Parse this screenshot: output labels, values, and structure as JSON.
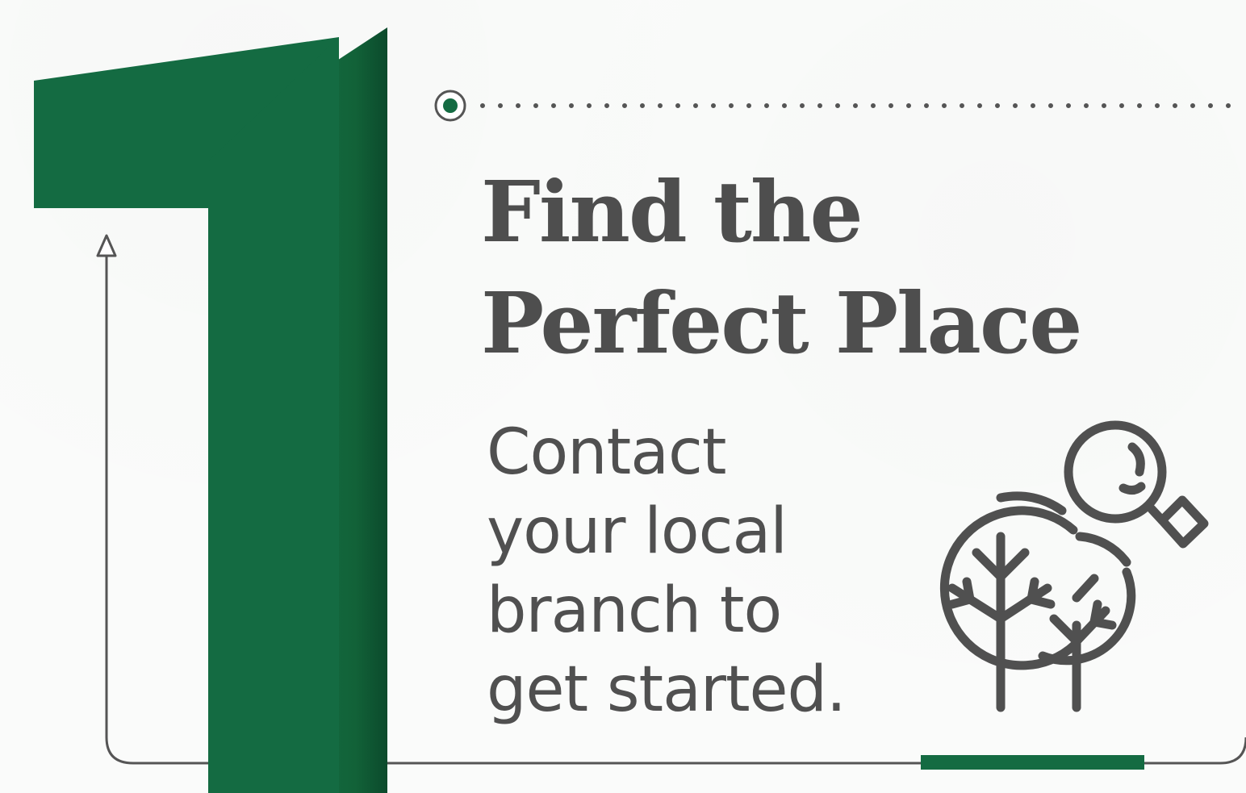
{
  "colors": {
    "accent_green": "#146b42",
    "accent_green_shadow": "#0b4a2c",
    "text_gray": "#505050",
    "line_gray": "#555555",
    "background": "#fafbfa"
  },
  "step": {
    "number": "1"
  },
  "heading": {
    "lines": [
      "Find the",
      "Perfect Place"
    ]
  },
  "description": {
    "lines": [
      "Contact",
      "your local",
      "branch to",
      "get started."
    ]
  },
  "icons": {
    "step_numeral": "numeral-one-shape",
    "illustration": "trees-with-magnifying-glass-icon",
    "timeline_start": "timeline-dot-icon",
    "arrow": "up-arrow-icon"
  }
}
